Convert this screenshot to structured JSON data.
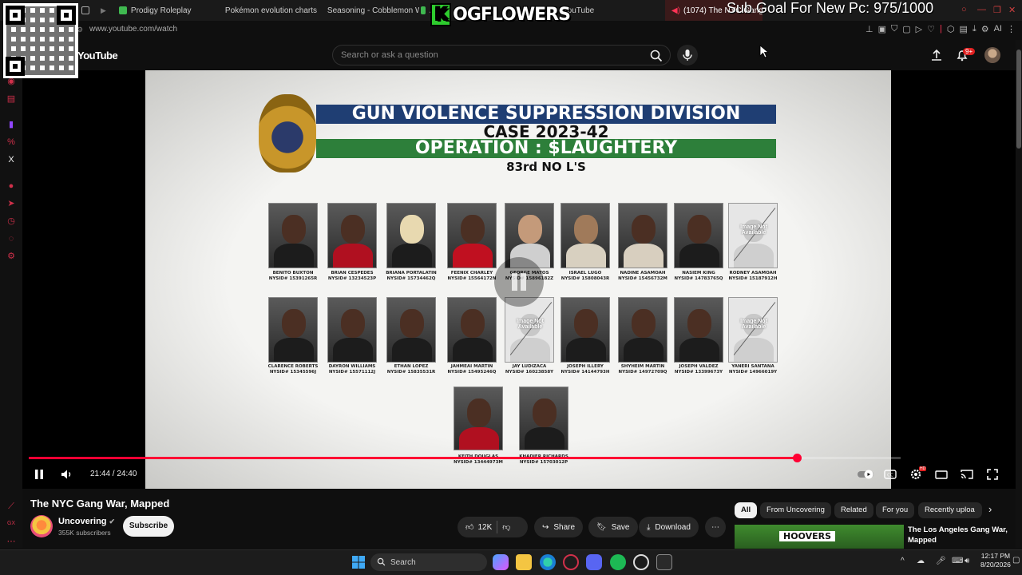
{
  "browser": {
    "tabs": [
      {
        "label": "Prodigy Roleplay",
        "color": "#3fb950"
      },
      {
        "label": "Pokémon evolution charts",
        "color": "#e25a3a"
      },
      {
        "label": "Seasoning - Cobblemon W",
        "color": "#d0304a"
      },
      {
        "label": "A",
        "color": "#3fb950"
      },
      {
        "label": "YouTube",
        "color": "#ff0033"
      },
      {
        "label": "(1074) The NYC Gang W",
        "color": "#ff0033"
      }
    ],
    "url": "www.youtube.com/watch"
  },
  "overlay": {
    "brand_k": "K",
    "brand_text": "OGFLOWERS",
    "sub_goal": "Sub Goal For New Pc: 975/1000"
  },
  "header": {
    "logo": "YouTube",
    "search_placeholder": "Search or ask a question",
    "notif_count": "9+"
  },
  "video_frame": {
    "bar1": "GUN VIOLENCE SUPPRESSION DIVISION",
    "bar2": "CASE 2023-42",
    "bar3": "OPERATION : $LAUGHTERY",
    "bar4": "83rd NO L'S",
    "not_available": "Image Not Available",
    "row1": [
      {
        "name": "BENITO BUXTON",
        "id": "NYSID# 15391265R"
      },
      {
        "name": "BRIAN CESPEDES",
        "id": "NYSID# 13234523P"
      },
      {
        "name": "BRIANA PORTALATIN",
        "id": "NYSID# 15734462Q"
      },
      {
        "name": "FEENIX CHARLEY",
        "id": "NYSID# 15564172N"
      },
      {
        "name": "GEORGE MATOS",
        "id": "NYSID# 15896182Z"
      },
      {
        "name": "ISRAEL LUGO",
        "id": "NYSID# 15808043R"
      },
      {
        "name": "NADINE ASAMOAH",
        "id": "NYSID# 15456732M"
      },
      {
        "name": "NASIEM KING",
        "id": "NYSID# 14783765Q"
      },
      {
        "name": "RODNEY ASAMOAH",
        "id": "NYSID# 15187912H"
      }
    ],
    "row2": [
      {
        "name": "CLARENCE ROBERTS",
        "id": "NYSID# 15345596J"
      },
      {
        "name": "DAYRON WILLIAMS",
        "id": "NYSID# 15571112J"
      },
      {
        "name": "ETHAN LOPEZ",
        "id": "NYSID# 15835531R"
      },
      {
        "name": "JAHMEAI MARTIN",
        "id": "NYSID# 15495246Q"
      },
      {
        "name": "JAY LUDIZACA",
        "id": "NYSID# 16023858Y"
      },
      {
        "name": "JOSEPH ILLERY",
        "id": "NYSID# 14144793H"
      },
      {
        "name": "SHYHEIM MARTIN",
        "id": "NYSID# 14972709Q"
      },
      {
        "name": "JOSEPH VALDEZ",
        "id": "NYSID# 13399673Y"
      },
      {
        "name": "YANERI SANTANA",
        "id": "NYSID# 14966019Y"
      }
    ],
    "row3": [
      {
        "name": "KEITH DOUGLAS",
        "id": "NYSID# 13444973M"
      },
      {
        "name": "KHADIER RICHARDS",
        "id": "NYSID# 15703012P"
      }
    ]
  },
  "player": {
    "time": "21:44 / 24:40",
    "progress": 0.8811,
    "hd": "HD"
  },
  "video": {
    "title": "The NYC Gang War, Mapped",
    "channel": "Uncovering",
    "subscribers": "355K subscribers",
    "subscribe_label": "Subscribe",
    "likes": "12K",
    "share": "Share",
    "save": "Save",
    "download": "Download"
  },
  "chips": [
    "All",
    "From Uncovering",
    "Related",
    "For you",
    "Recently uploa"
  ],
  "recommended": {
    "thumb_text": "HOOVERS",
    "title": "The Los Angeles Gang War, Mapped"
  },
  "taskbar": {
    "search": "Search",
    "time": "12:17 PM",
    "date": "8/20/2026"
  }
}
